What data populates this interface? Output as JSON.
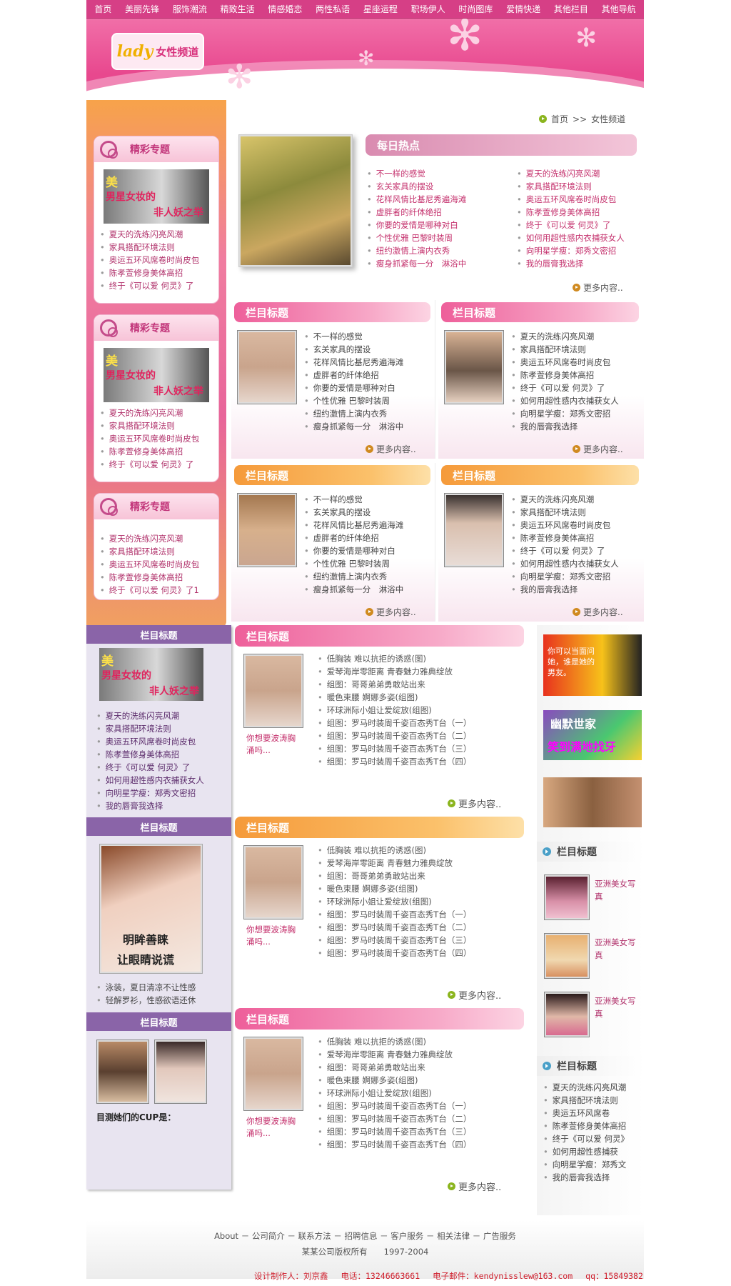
{
  "nav": [
    "首页",
    "美丽先锋",
    "服饰潮流",
    "精致生活",
    "情感婚恋",
    "两性私语",
    "星座运程",
    "职场伊人",
    "时尚图库",
    "爱情快递",
    "其他栏目",
    "其他导航"
  ],
  "logo": {
    "en": "lady",
    "cn": "女性频道"
  },
  "breadcrumb": {
    "home": "首页",
    "sep": ">>",
    "current": "女性频道"
  },
  "sidebar_topics": [
    {
      "title": "精彩专题",
      "img_text": [
        "美",
        "男星女妆的",
        "非人妖之举"
      ],
      "items": [
        "夏天的洗练闪亮风潮",
        "家具搭配环境法则",
        "奥运五环风席卷时尚皮包",
        "陈孝萱修身美体高招",
        "终于《可以爱 何灵》了"
      ]
    },
    {
      "title": "精彩专题",
      "img_text": [
        "美",
        "男星女妆的",
        "非人妖之举"
      ],
      "items": [
        "夏天的洗练闪亮风潮",
        "家具搭配环境法则",
        "奥运五环风席卷时尚皮包",
        "陈孝萱修身美体高招",
        "终于《可以爱 何灵》了"
      ]
    },
    {
      "title": "精彩专题",
      "items": [
        "夏天的洗练闪亮风潮",
        "家具搭配环境法则",
        "奥运五环风席卷时尚皮包",
        "陈孝萱修身美体高招",
        "终于《可以爱 何灵》了1"
      ]
    }
  ],
  "hot": {
    "title": "每日热点",
    "col1": [
      "不一样的感觉",
      "玄关家具的摆设",
      "花样风情比基尼秀遍海滩",
      "虚胖者的纤体绝招",
      "你要的爱情是哪种对白",
      "个性优雅 巴黎时装周",
      "纽约激情上演内衣秀",
      "瘦身抓紧每一分　淋浴中"
    ],
    "col2": [
      "夏天的洗练闪亮风潮",
      "家具搭配环境法则",
      "奥运五环风席卷时尚皮包",
      "陈孝萱修身美体高招",
      "终于《可以爱 何灵》了",
      "如何用超性感内衣捕获女人",
      "向明星学瘦：郑秀文密招",
      "我的唇膏我选择"
    ],
    "more": "更多内容.."
  },
  "grid": [
    {
      "title": "栏目标题",
      "items": [
        "不一样的感觉",
        "玄关家具的摆设",
        "花样风情比基尼秀遍海滩",
        "虚胖者的纤体绝招",
        "你要的爱情是哪种对白",
        "个性优雅 巴黎时装周",
        "纽约激情上演内衣秀",
        "瘦身抓紧每一分　淋浴中"
      ],
      "more": "更多内容.."
    },
    {
      "title": "栏目标题",
      "items": [
        "夏天的洗练闪亮风潮",
        "家具搭配环境法则",
        "奥运五环风席卷时尚皮包",
        "陈孝萱修身美体高招",
        "终于《可以爱 何灵》了",
        "如何用超性感内衣捕获女人",
        "向明星学瘦：郑秀文密招",
        "我的唇膏我选择"
      ],
      "more": "更多内容.."
    },
    {
      "title": "栏目标题",
      "items": [
        "不一样的感觉",
        "玄关家具的摆设",
        "花样风情比基尼秀遍海滩",
        "虚胖者的纤体绝招",
        "你要的爱情是哪种对白",
        "个性优雅 巴黎时装周",
        "纽约激情上演内衣秀",
        "瘦身抓紧每一分　淋浴中"
      ],
      "more": "更多内容.."
    },
    {
      "title": "栏目标题",
      "items": [
        "夏天的洗练闪亮风潮",
        "家具搭配环境法则",
        "奥运五环风席卷时尚皮包",
        "陈孝萱修身美体高招",
        "终于《可以爱 何灵》了",
        "如何用超性感内衣捕获女人",
        "向明星学瘦：郑秀文密招",
        "我的唇膏我选择"
      ],
      "more": "更多内容.."
    }
  ],
  "purple": [
    {
      "title": "栏目标题",
      "img_text": [
        "美",
        "男星女妆的",
        "非人妖之举"
      ],
      "items": [
        "夏天的洗练闪亮风潮",
        "家具搭配环境法则",
        "奥运五环风席卷时尚皮包",
        "陈孝萱修身美体高招",
        "终于《可以爱 何灵》了",
        "如何用超性感内衣捕获女人",
        "向明星学瘦：郑秀文密招",
        "我的唇膏我选择"
      ]
    },
    {
      "title": "栏目标题",
      "img_text": [
        "明眸善睐",
        "让眼睛说谎"
      ],
      "items": [
        "泳装，夏日清凉不让性感",
        "轻解罗衫，性感欲语还休"
      ]
    },
    {
      "title": "栏目标题",
      "caption": "目测她们的CUP是："
    }
  ],
  "middle": [
    {
      "title": "栏目标题",
      "caption": "你想要波涛胸涌吗...",
      "items": [
        "低胸装 难以抗拒的诱惑(图)",
        "爱琴海岸零距离 青春魅力雅典绽放",
        "组图：哥哥弟弟勇敢站出来",
        "暖色束腰 婀娜多姿(组图)",
        "环球洲际小姐让爱绽放(组图)",
        "组图：罗马时装周千姿百态秀T台（一）",
        "组图：罗马时装周千姿百态秀T台（二）",
        "组图：罗马时装周千姿百态秀T台（三）",
        "组图：罗马时装周千姿百态秀T台（四）"
      ],
      "more": "更多内容.."
    },
    {
      "title": "栏目标题",
      "caption": "你想要波涛胸涌吗...",
      "items": [
        "低胸装 难以抗拒的诱惑(图)",
        "爱琴海岸零距离 青春魅力雅典绽放",
        "组图：哥哥弟弟勇敢站出来",
        "暖色束腰 婀娜多姿(组图)",
        "环球洲际小姐让爱绽放(组图)",
        "组图：罗马时装周千姿百态秀T台（一）",
        "组图：罗马时装周千姿百态秀T台（二）",
        "组图：罗马时装周千姿百态秀T台（三）",
        "组图：罗马时装周千姿百态秀T台（四）"
      ],
      "more": "更多内容.."
    },
    {
      "title": "栏目标题",
      "caption": "你想要波涛胸涌吗...",
      "items": [
        "低胸装 难以抗拒的诱惑(图)",
        "爱琴海岸零距离 青春魅力雅典绽放",
        "组图：哥哥弟弟勇敢站出来",
        "暖色束腰 婀娜多姿(组图)",
        "环球洲际小姐让爱绽放(组图)",
        "组图：罗马时装周千姿百态秀T台（一）",
        "组图：罗马时装周千姿百态秀T台（二）",
        "组图：罗马时装周千姿百态秀T台（三）",
        "组图：罗马时装周千姿百态秀T台（四）"
      ],
      "more": "更多内容.."
    }
  ],
  "ads": {
    "ad1": "你可以当面问她，谁是她的男友。",
    "ad2a": "幽默世家",
    "ad2b": "笑到满地找牙"
  },
  "right1": {
    "title": "栏目标题",
    "items": [
      "亚洲美女写真",
      "亚洲美女写真",
      "亚洲美女写真"
    ]
  },
  "right2": {
    "title": "栏目标题",
    "items": [
      "夏天的洗练闪亮风潮",
      "家具搭配环境法则",
      "奥运五环风席卷",
      "陈孝萱修身美体高招",
      "终于《可以爱 何灵》",
      "如何用超性感捕获",
      "向明星学瘦：郑秀文",
      "我的唇膏我选择"
    ]
  },
  "footer": {
    "links": "About － 公司简介 － 联系方法 － 招聘信息 － 客户服务 － 相关法律 － 广告服务",
    "copy": "某某公司版权所有　　1997-2004"
  },
  "credit": {
    "designer": "设计制作人：刘京鑫",
    "phone": "电话：13246663661",
    "email": "电子邮件：kendynisslew@163.com",
    "qq": "qq：15849382"
  }
}
